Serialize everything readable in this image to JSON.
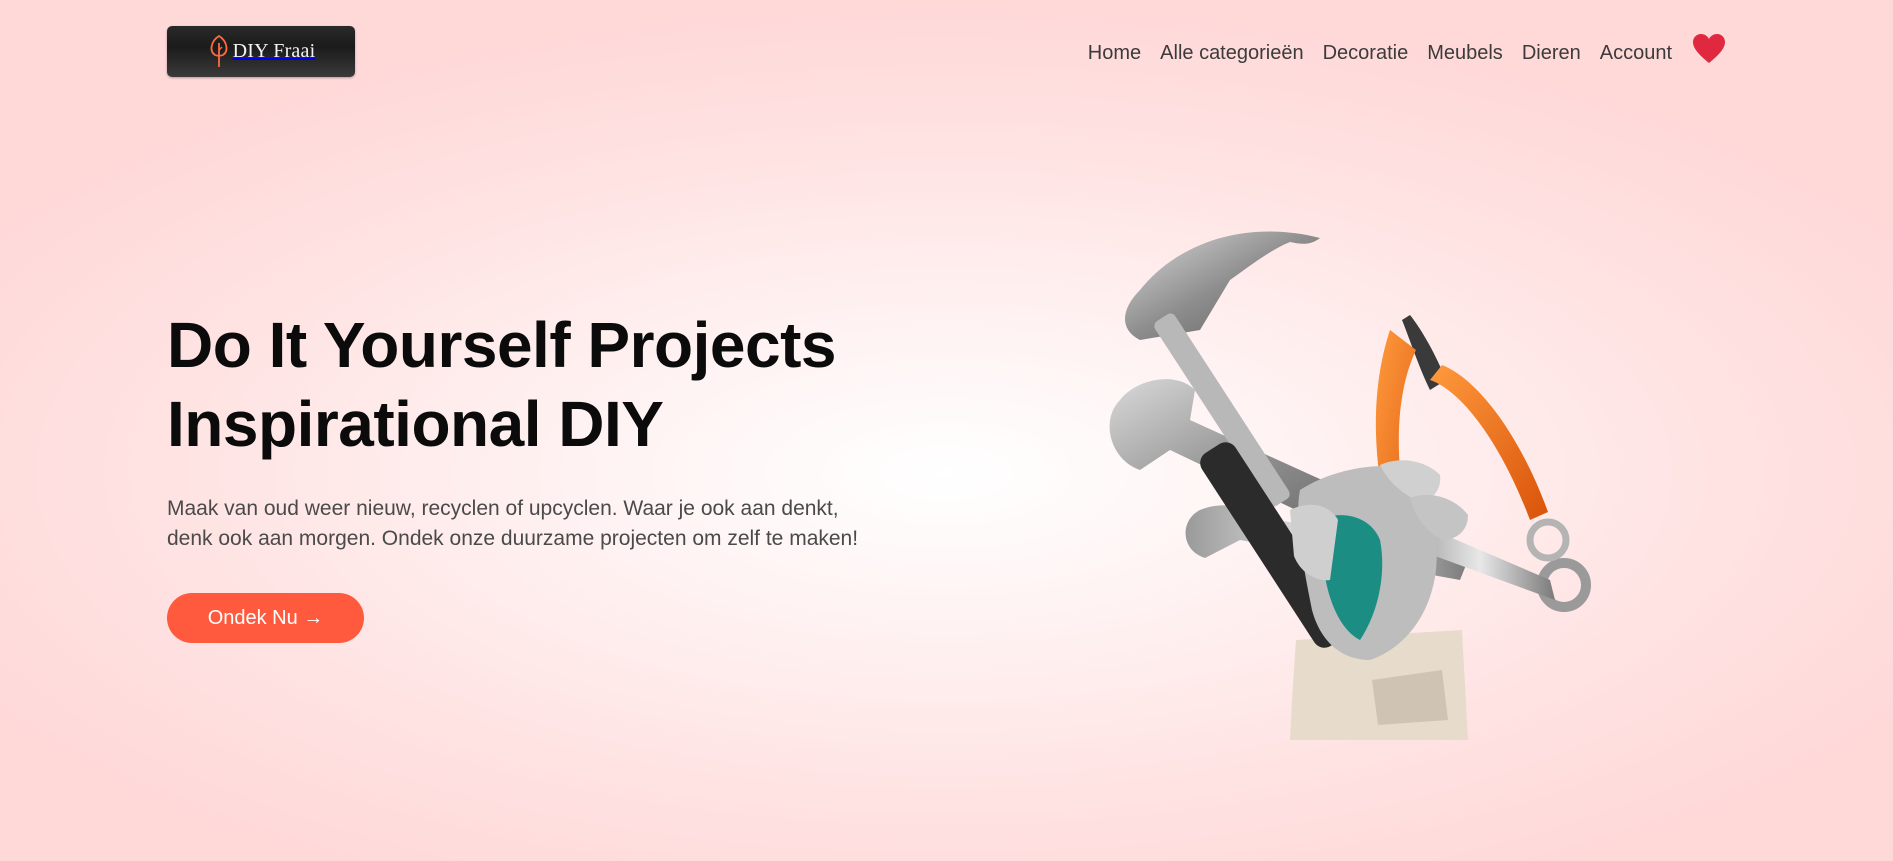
{
  "brand": {
    "logo_text": "DIY Fraai",
    "logo_icon": "tree-icon"
  },
  "nav": {
    "items": [
      {
        "label": "Home"
      },
      {
        "label": "Alle categorieën"
      },
      {
        "label": "Decoratie"
      },
      {
        "label": "Meubels"
      },
      {
        "label": "Dieren"
      },
      {
        "label": "Account"
      }
    ],
    "favorites_icon": "heart-icon",
    "favorites_color": "#e0283f"
  },
  "hero": {
    "title_line1": "Do It Yourself Projects",
    "title_line2": "Inspirational DIY",
    "subtitle_line1": "Maak van oud weer nieuw, recyclen of upcyclen. Waar je ook aan denkt,",
    "subtitle_line2": "denk ook aan morgen. Ondek onze duurzame projecten om zelf te maken!",
    "cta_label": "Ondek Nu →",
    "cta_color": "#ff5a3d",
    "image": "hand-holding-tools-illustration"
  }
}
